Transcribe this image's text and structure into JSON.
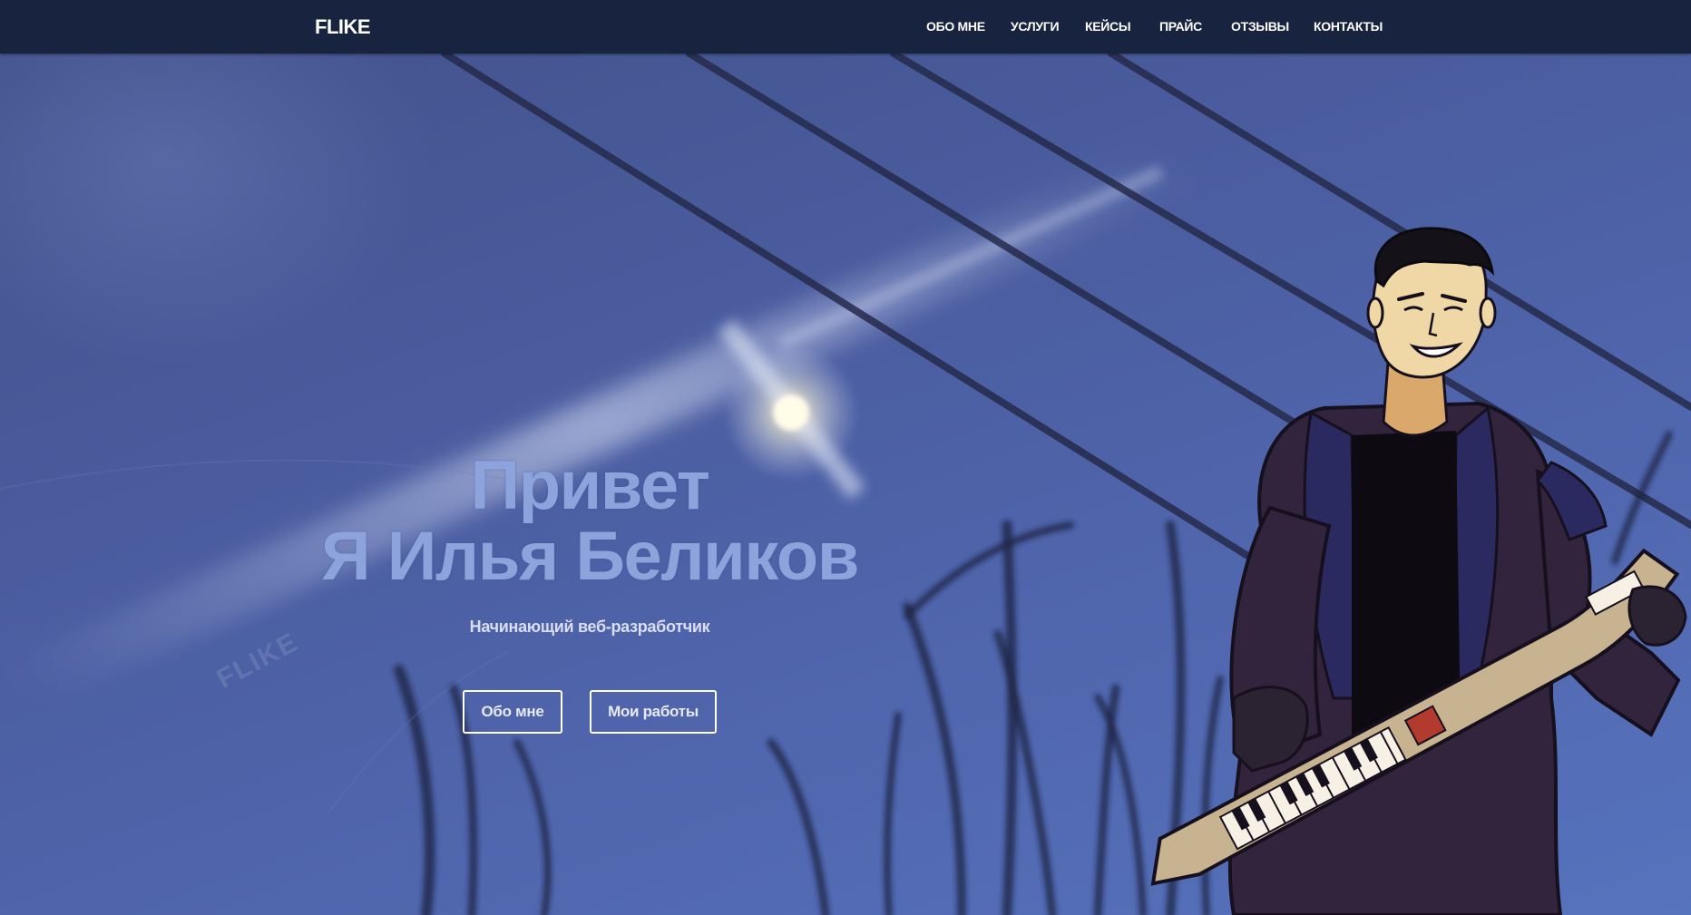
{
  "header": {
    "logo": "FLIKE",
    "nav": [
      {
        "id": "about",
        "label": "ОБО МНЕ"
      },
      {
        "id": "services",
        "label": "УСЛУГИ"
      },
      {
        "id": "cases",
        "label": "КЕЙСЫ"
      },
      {
        "id": "price",
        "label": "ПРАЙС"
      },
      {
        "id": "reviews",
        "label": "ОТЗЫВЫ"
      },
      {
        "id": "contacts",
        "label": "КОНТАКТЫ"
      }
    ]
  },
  "hero": {
    "title_line1": "Привет",
    "title_line2": "Я Илья Беликов",
    "subtitle": "Начинающий веб-разработчик",
    "buttons": {
      "about": "Обо мне",
      "works": "Мои работы"
    },
    "watermark": "FLIKE"
  },
  "colors": {
    "header_bg": "#17233f",
    "hero_bg": "#4a5c9e",
    "title": "#8da3db",
    "text": "#ffffff"
  }
}
